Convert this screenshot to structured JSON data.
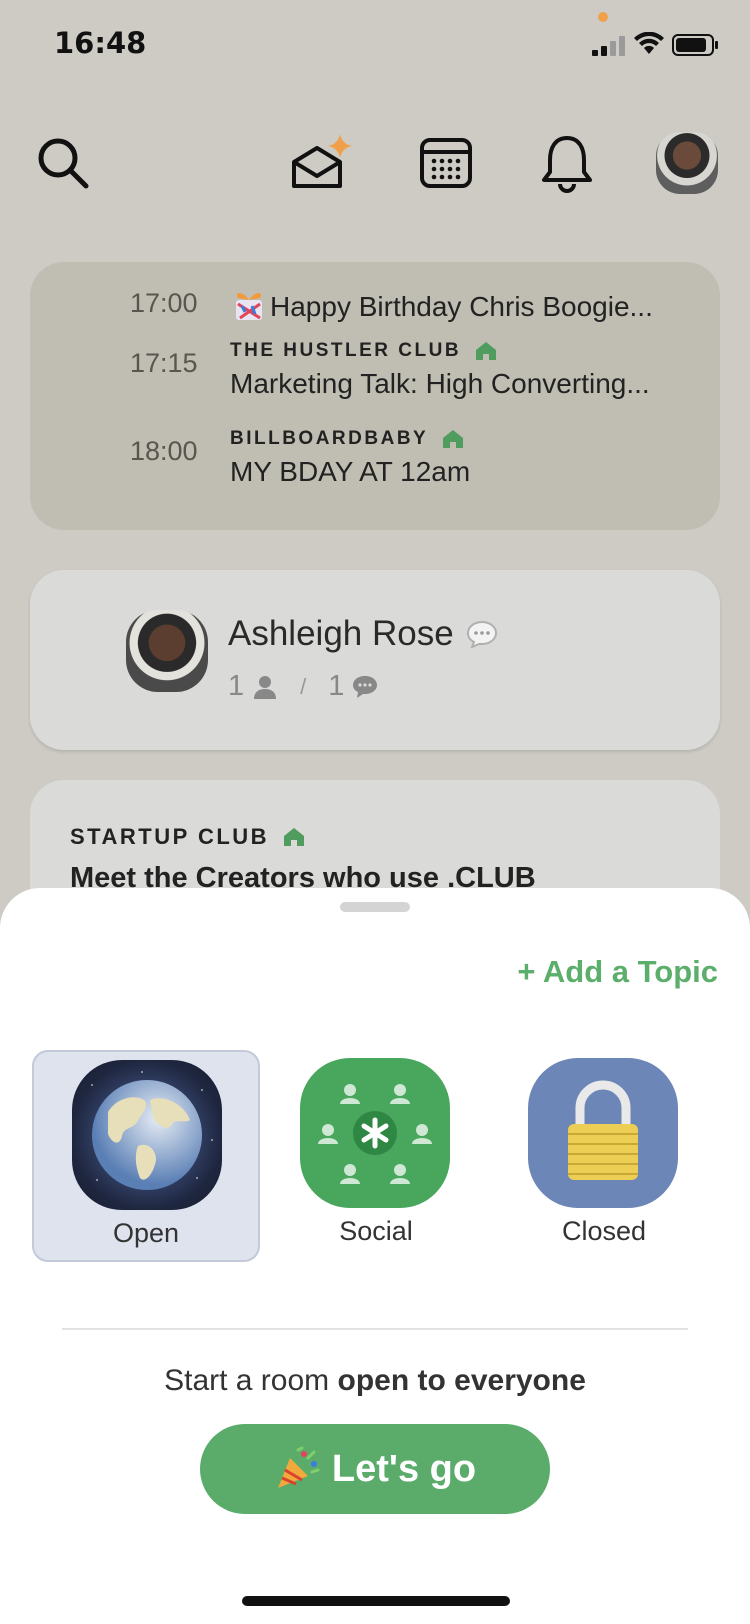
{
  "status_bar": {
    "time": "16:48"
  },
  "nav": {
    "icons": [
      "search-icon",
      "invite-envelope-icon",
      "calendar-icon",
      "bell-icon",
      "profile-avatar"
    ]
  },
  "upcoming": {
    "events": [
      {
        "time": "17:00",
        "club": "",
        "title": "Happy Birthday Chris Boogie..."
      },
      {
        "time": "17:15",
        "club": "THE HUSTLER CLUB",
        "title": "Marketing Talk: High Converting..."
      },
      {
        "time": "18:00",
        "club": "BILLBOARDBABY",
        "title": "MY BDAY AT 12am"
      }
    ]
  },
  "hallway": {
    "name": "Ashleigh Rose",
    "listeners": "1",
    "speakers": "1",
    "separator": "/"
  },
  "room_preview": {
    "club": "STARTUP CLUB",
    "title": "Meet the Creators who use .CLUB"
  },
  "sheet": {
    "add_topic": "+ Add a Topic",
    "room_types": [
      {
        "label": "Open",
        "selected": true
      },
      {
        "label": "Social",
        "selected": false
      },
      {
        "label": "Closed",
        "selected": false
      }
    ],
    "description_prefix": "Start a room ",
    "description_bold": "open to everyone",
    "go_button": "Let's go"
  },
  "colors": {
    "accent_green": "#5bac6b",
    "background": "#cdcbc4",
    "card_upcoming": "#c0beb2",
    "selected_bg": "#dfe3ee"
  }
}
